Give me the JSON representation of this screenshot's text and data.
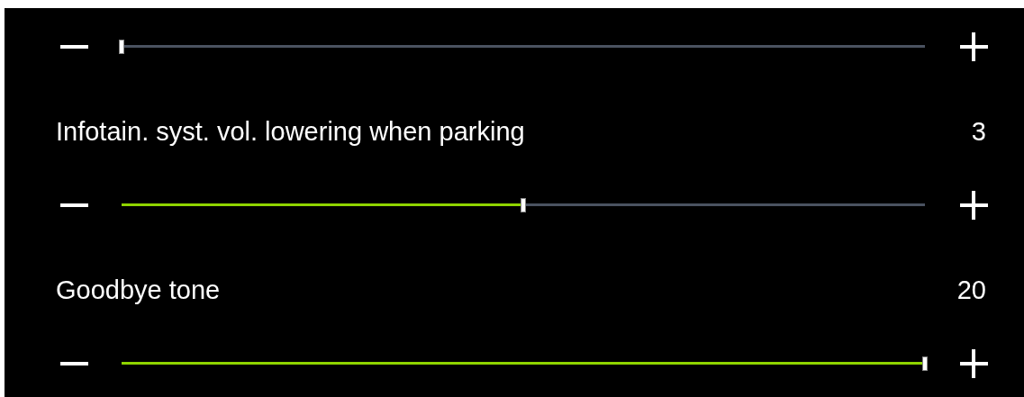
{
  "settings": [
    {
      "level": 0
    },
    {
      "label": "Infotain. syst. vol. lowering when parking",
      "value": "3",
      "level": 0.5
    },
    {
      "label": "Goodbye tone",
      "value": "20",
      "level": 1
    }
  ]
}
